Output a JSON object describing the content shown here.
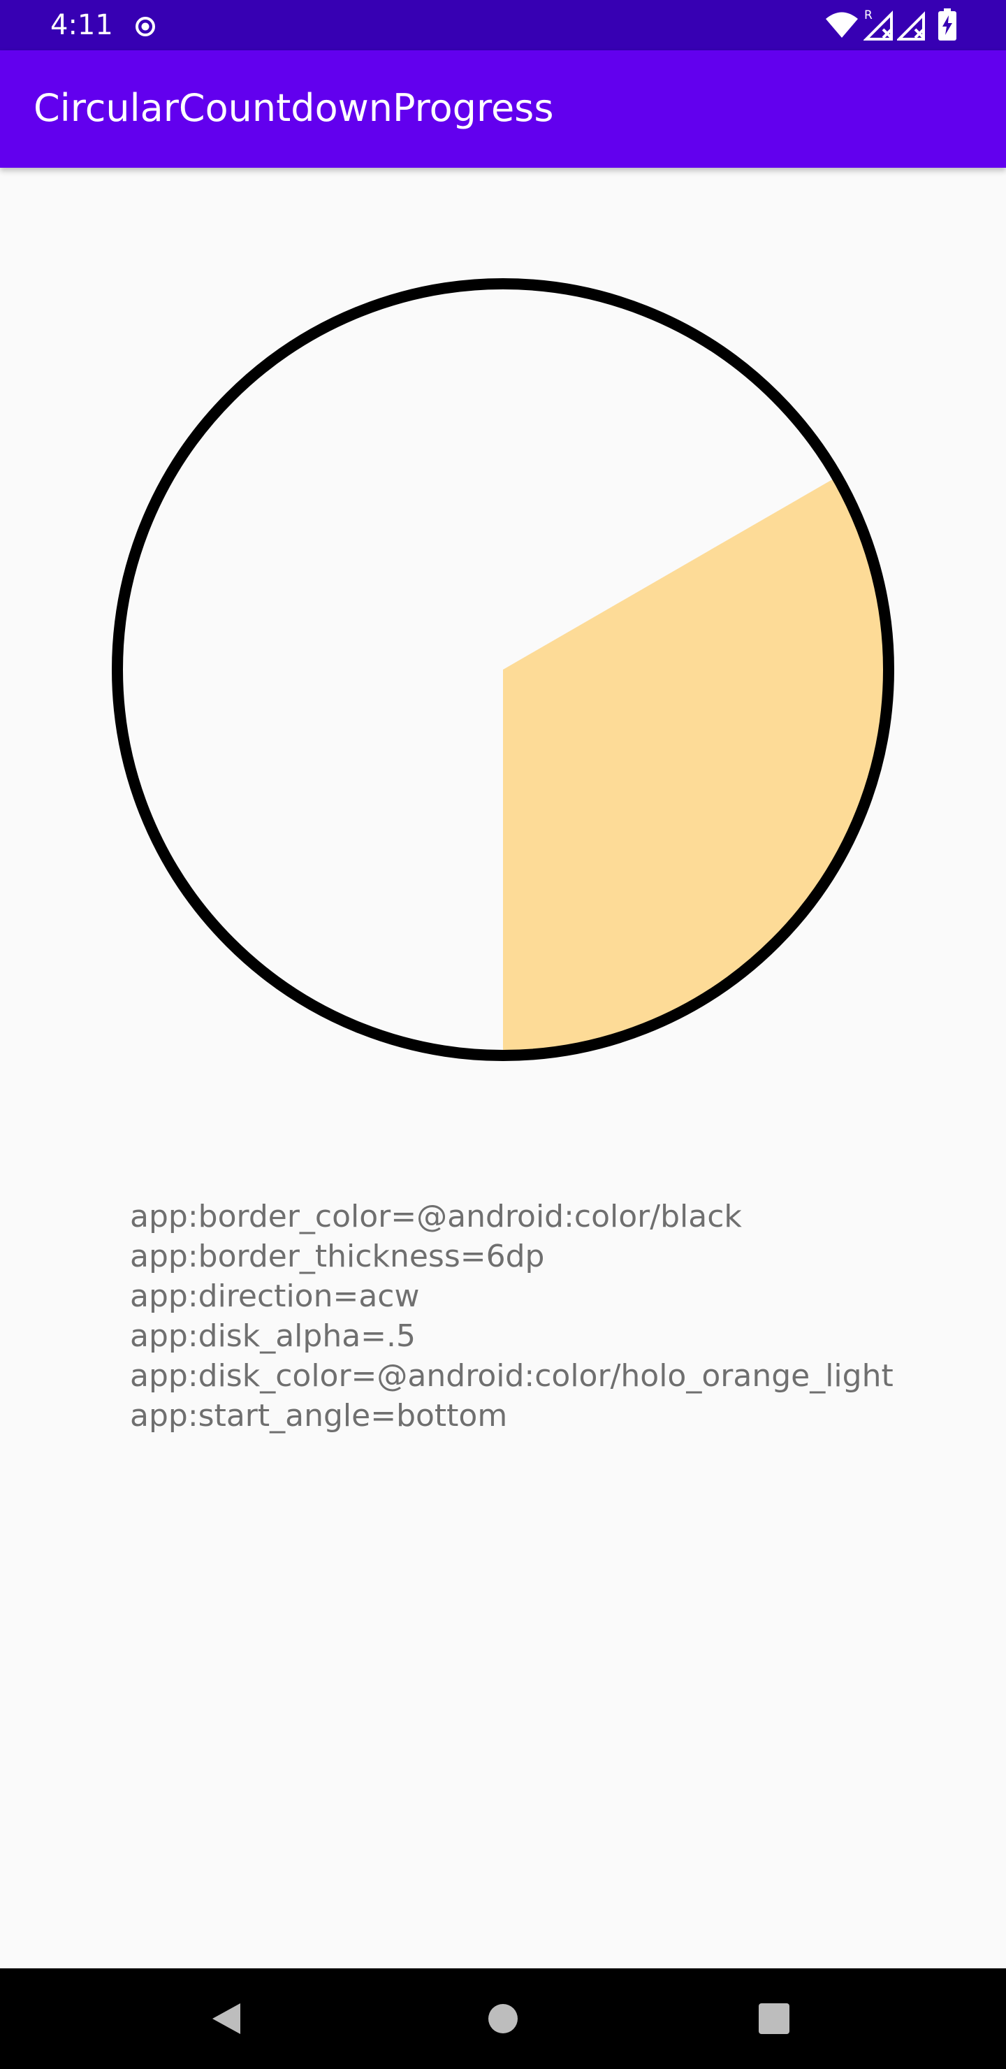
{
  "status_bar": {
    "time": "4:11",
    "icons": [
      "radio-dot-icon",
      "wifi-icon",
      "roaming-signal-icon",
      "signal-icon",
      "battery-charging-icon"
    ],
    "roaming_letter": "R"
  },
  "app_bar": {
    "title": "CircularCountdownProgress"
  },
  "progress_view": {
    "border_color": "#000000",
    "disk_color": "#FFBB33",
    "disk_alpha": 0.5,
    "direction": "acw",
    "start_angle": "bottom",
    "progress_fraction": 0.3333
  },
  "attributes": [
    "app:border_color=@android:color/black",
    "app:border_thickness=6dp",
    "app:direction=acw",
    "app:disk_alpha=.5",
    "app:disk_color=@android:color/holo_orange_light",
    "app:start_angle=bottom"
  ],
  "nav_bar": {
    "buttons": [
      "back-icon",
      "home-icon",
      "recents-icon"
    ]
  }
}
